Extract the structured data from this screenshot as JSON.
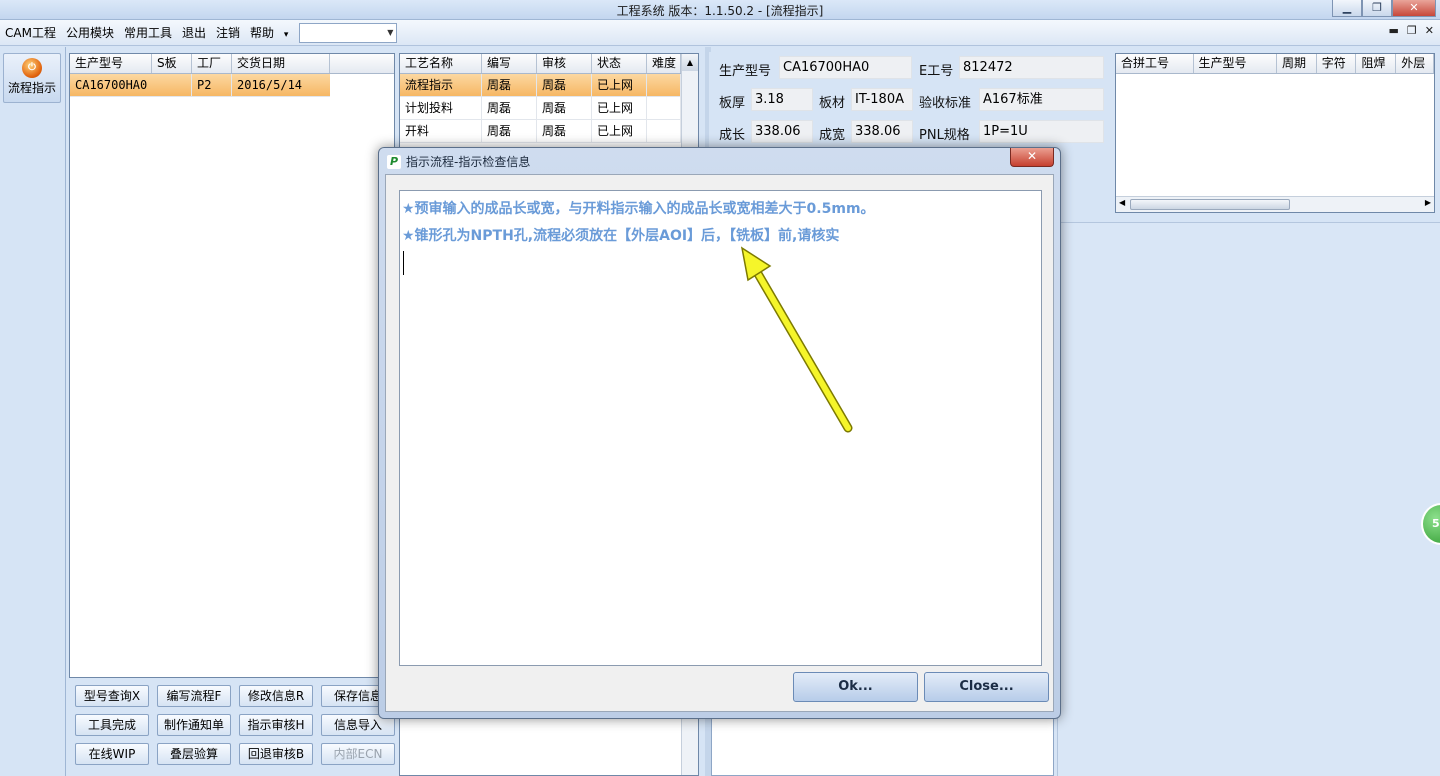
{
  "window": {
    "title": "工程系统    版本：1.1.50.2 - [流程指示]",
    "min_label": "▁",
    "max_label": "❐",
    "close_label": "✕"
  },
  "menu": {
    "items": [
      "CAM工程",
      "公用模块",
      "常用工具",
      "退出",
      "注销",
      "帮助"
    ],
    "help_arrow": "▾",
    "combo_value": ""
  },
  "nav": {
    "label": "流程指示"
  },
  "order_grid": {
    "headers": [
      "生产型号",
      "S板",
      "工厂",
      "交货日期"
    ],
    "rows": [
      {
        "model": "CA16700HA0",
        "s": "",
        "factory": "P2",
        "date": "2016/5/14"
      }
    ]
  },
  "process_grid": {
    "headers": [
      "工艺名称",
      "编写",
      "审核",
      "状态",
      "难度"
    ],
    "rows": [
      {
        "name": "流程指示",
        "writer": "周磊",
        "reviewer": "周磊",
        "status": "已上网"
      },
      {
        "name": "计划投料",
        "writer": "周磊",
        "reviewer": "周磊",
        "status": "已上网"
      },
      {
        "name": "开料",
        "writer": "周磊",
        "reviewer": "周磊",
        "status": "已上网"
      }
    ]
  },
  "buttons": {
    "row1": [
      "型号查询X",
      "编写流程F",
      "修改信息R",
      "保存信息"
    ],
    "row2": [
      "工具完成",
      "制作通知单",
      "指示审核H",
      "信息导入"
    ],
    "row3": [
      "在线WIP",
      "叠层验算",
      "回退审核B",
      "内部ECN"
    ]
  },
  "info": {
    "model_label": "生产型号",
    "model_value": "CA16700HA0",
    "eno_label": "E工号",
    "eno_value": "812472",
    "thickness_label": "板厚",
    "thickness_value": "3.18",
    "material_label": "板材",
    "material_value": "IT-180A",
    "standard_label": "验收标准",
    "standard_value": "A167标准",
    "length_label": "成长",
    "length_value": "338.06",
    "width_label": "成宽",
    "width_value": "338.06",
    "pnl_label": "PNL规格",
    "pnl_value": "1P=1U"
  },
  "merge_grid": {
    "headers": [
      "合拼工号",
      "生产型号",
      "周期",
      "字符",
      "阻焊",
      "外层"
    ]
  },
  "dialog": {
    "title": "指示流程-指示检查信息",
    "close_label": "✕",
    "messages": [
      "★预审输入的成品长或宽，与开料指示输入的成品长或宽相差大于0.5mm。",
      "★锥形孔为NPTH孔,流程必须放在【外层AOI】后，【铣板】前,请核实"
    ],
    "ok_label": "Ok...",
    "close_button_label": "Close..."
  },
  "badge": {
    "value": "59"
  },
  "colors": {
    "accent": "#6a9bd8",
    "selection": "#f6b764",
    "arrow": "#f5f52a"
  }
}
